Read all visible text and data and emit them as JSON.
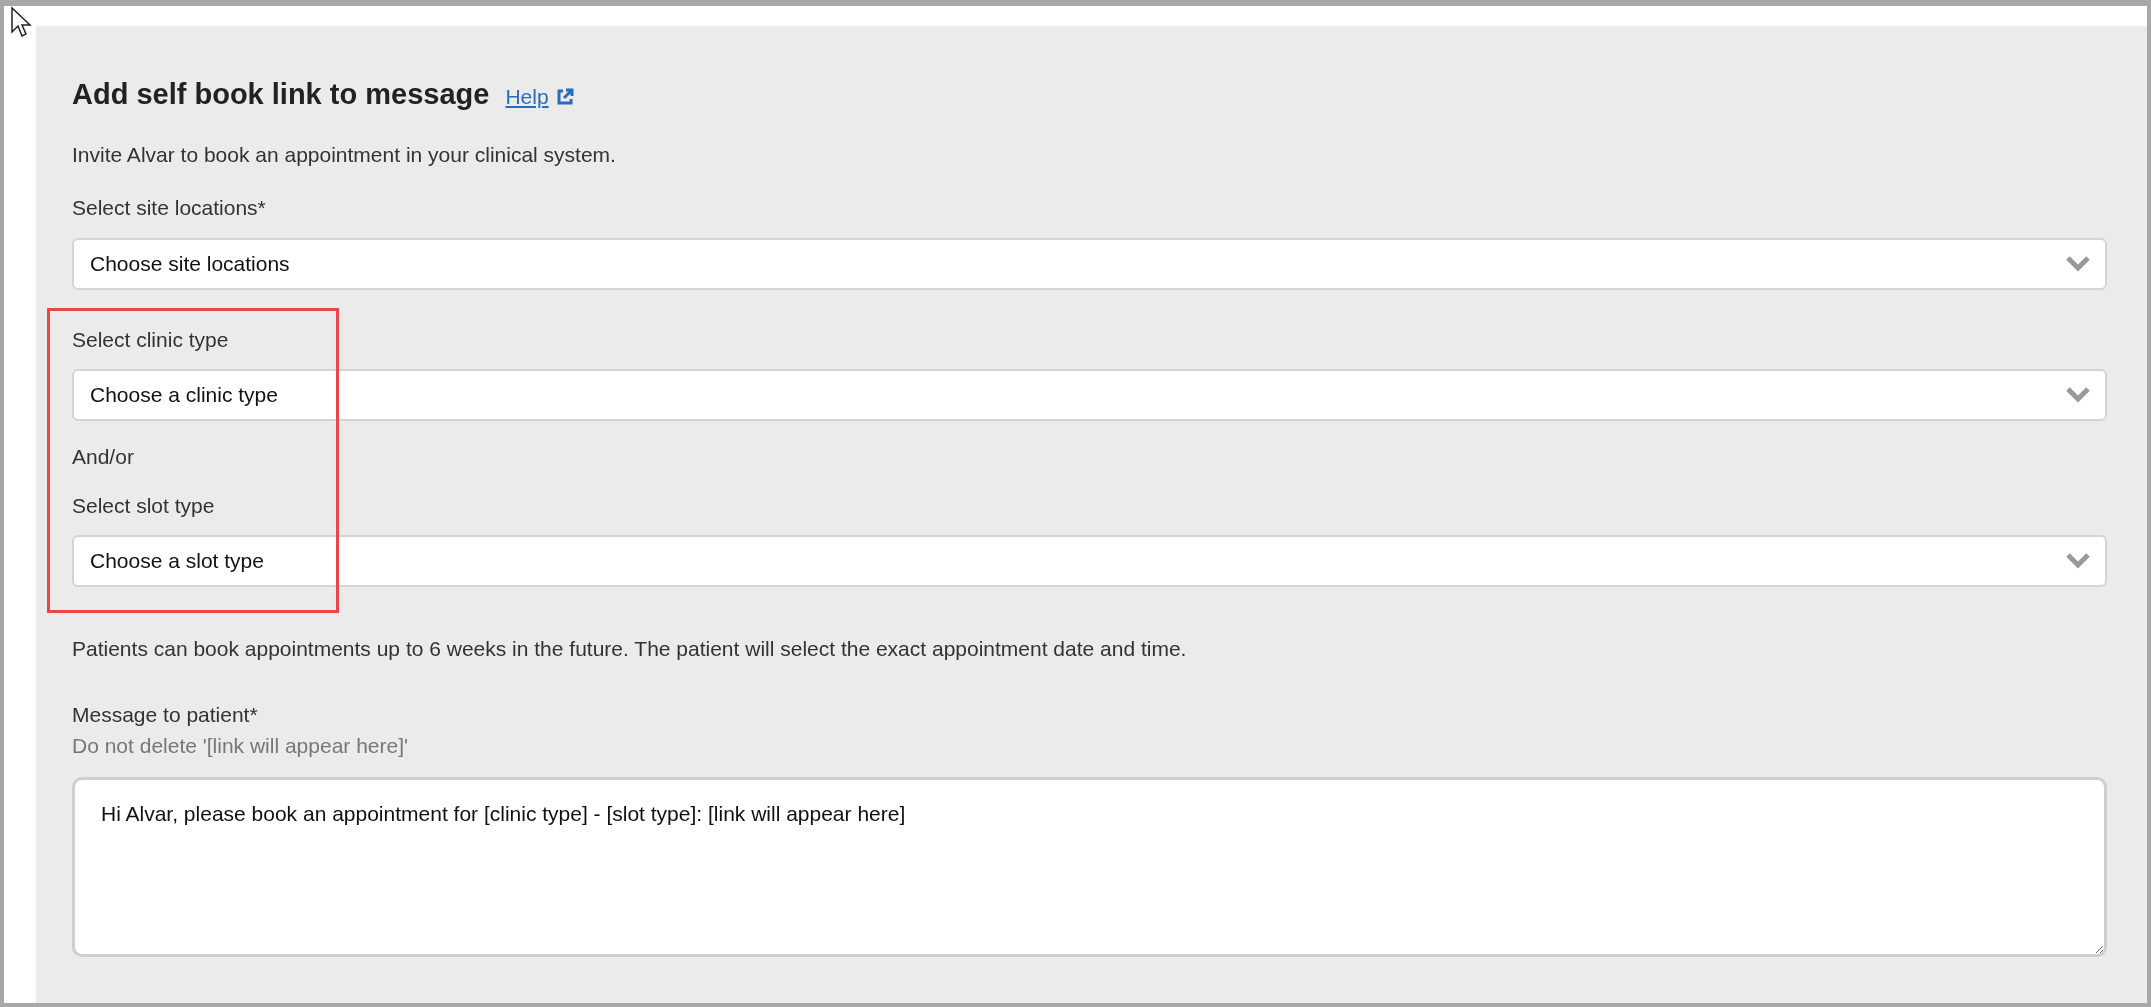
{
  "panel": {
    "title": "Add self book link to message",
    "help_link": "Help",
    "intro": "Invite Alvar to book an appointment in your clinical system.",
    "fields": [
      {
        "kind": "select",
        "label": "Select site locations*",
        "placeholder": "Choose site locations"
      },
      {
        "kind": "select",
        "label": "Select clinic type",
        "placeholder": "Choose a clinic type"
      },
      {
        "kind": "note",
        "text": "And/or"
      },
      {
        "kind": "select",
        "label": "Select slot type",
        "placeholder": "Choose a slot type"
      }
    ],
    "booking_note": "Patients can book appointments up to 6 weeks in the future. The patient will select the exact appointment date and time.",
    "message": {
      "label": "Message to patient*",
      "hint": "Do not delete '[link will appear here]'",
      "value": "Hi Alvar, please book an appointment for [clinic type] - [slot type]: [link will appear here]"
    }
  }
}
